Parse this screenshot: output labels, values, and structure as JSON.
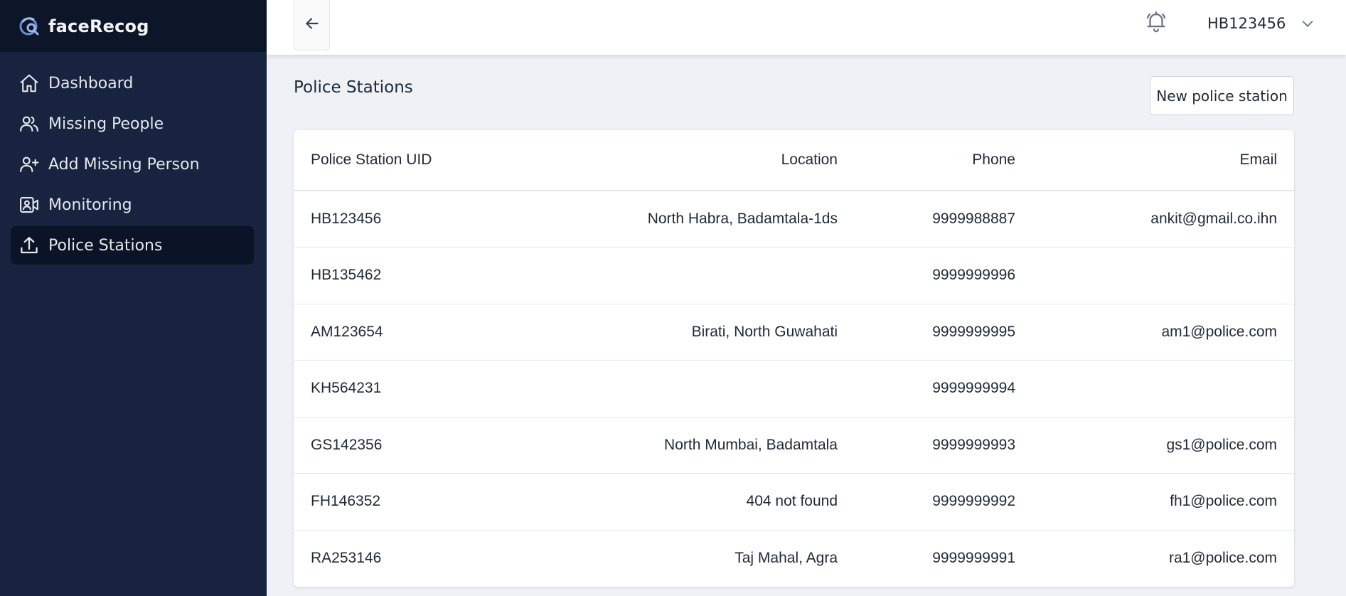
{
  "app": {
    "name": "faceRecog"
  },
  "sidebar": {
    "items": [
      {
        "label": "Dashboard",
        "icon": "home-icon",
        "active": false
      },
      {
        "label": "Missing People",
        "icon": "users-icon",
        "active": false
      },
      {
        "label": "Add Missing Person",
        "icon": "user-plus-icon",
        "active": false
      },
      {
        "label": "Monitoring",
        "icon": "video-icon",
        "active": false
      },
      {
        "label": "Police Stations",
        "icon": "upload-icon",
        "active": true
      }
    ]
  },
  "header": {
    "back_icon": "arrow-left-icon",
    "notification_icon": "bell-icon",
    "user": "HB123456",
    "menu_icon": "chevron-down-icon"
  },
  "main": {
    "title": "Police Stations",
    "new_button": "New police station",
    "table": {
      "columns": [
        "Police Station UID",
        "Location",
        "Phone",
        "Email"
      ],
      "rows": [
        [
          "HB123456",
          "North Habra, Badamtala-1ds",
          "9999988887",
          "ankit@gmail.co.ihn"
        ],
        [
          "HB135462",
          "",
          "9999999996",
          ""
        ],
        [
          "AM123654",
          "Birati, North Guwahati",
          "9999999995",
          "am1@police.com"
        ],
        [
          "KH564231",
          "",
          "9999999994",
          ""
        ],
        [
          "GS142356",
          "North Mumbai, Badamtala",
          "9999999993",
          "gs1@police.com"
        ],
        [
          "FH146352",
          "404 not found",
          "9999999992",
          "fh1@police.com"
        ],
        [
          "RA253146",
          "Taj Mahal, Agra",
          "9999999991",
          "ra1@police.com"
        ]
      ]
    }
  },
  "colors": {
    "sidebar_bg": "#17233f",
    "brand_bg": "#0d1628",
    "active_item_bg": "#0b1426",
    "page_bg": "#eef2f6",
    "logo_accent": "#6b8fd6"
  }
}
